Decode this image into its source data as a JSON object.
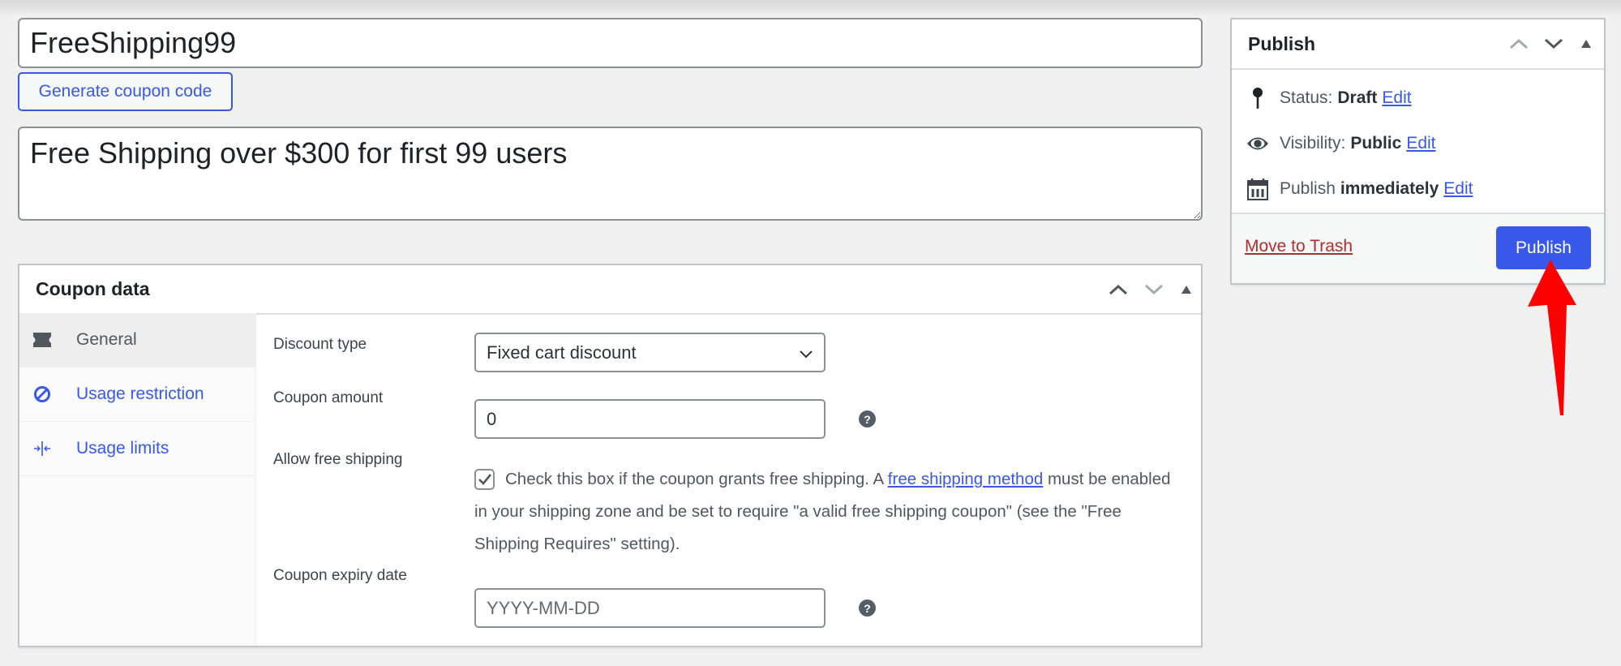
{
  "coupon": {
    "code_value": "FreeShipping99",
    "generate_button_label": "Generate coupon code",
    "description_value": "Free Shipping over $300 for first 99 users"
  },
  "coupon_data": {
    "title": "Coupon data",
    "tabs": [
      {
        "label": "General",
        "icon": "ticket-icon",
        "active": true
      },
      {
        "label": "Usage restriction",
        "icon": "restriction-icon",
        "active": false
      },
      {
        "label": "Usage limits",
        "icon": "limits-icon",
        "active": false
      }
    ],
    "fields": {
      "discount_type": {
        "label": "Discount type",
        "value": "Fixed cart discount"
      },
      "coupon_amount": {
        "label": "Coupon amount",
        "value": "0"
      },
      "free_shipping": {
        "label": "Allow free shipping",
        "checked": true,
        "text_before": "Check this box if the coupon grants free shipping. A ",
        "link_text": "free shipping method",
        "text_after": " must be enabled in your shipping zone and be set to require \"a valid free shipping coupon\" (see the \"Free Shipping Requires\" setting)."
      },
      "expiry_date": {
        "label": "Coupon expiry date",
        "value": "",
        "placeholder": "YYYY-MM-DD"
      }
    },
    "help_glyph": "?"
  },
  "publish": {
    "title": "Publish",
    "status_label": "Status:",
    "status_value": "Draft",
    "visibility_label": "Visibility:",
    "visibility_value": "Public",
    "schedule_label": "Publish",
    "schedule_value": "immediately",
    "edit_label": "Edit",
    "trash_label": "Move to Trash",
    "publish_button_label": "Publish"
  },
  "colors": {
    "accent": "#3858e9",
    "danger": "#b32d2e",
    "annotation": "#ff0000"
  }
}
